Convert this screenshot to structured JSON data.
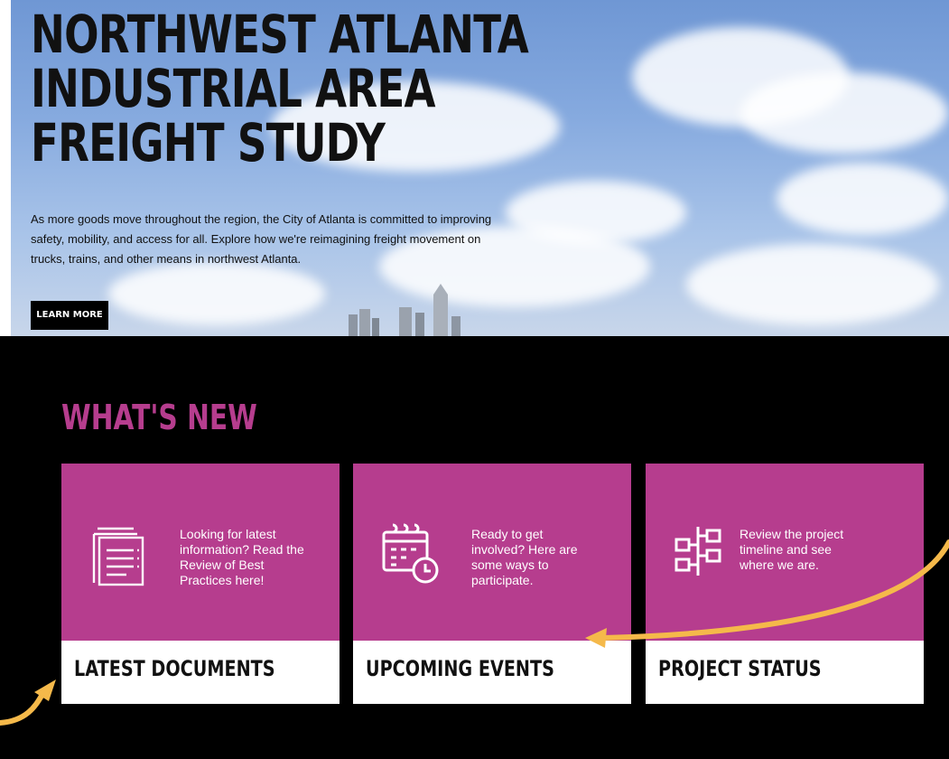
{
  "hero": {
    "title_lines": [
      "NORTHWEST ATLANTA",
      "INDUSTRIAL AREA",
      "FREIGHT STUDY"
    ],
    "description_lines": [
      "As more goods move throughout the region, the City of Atlanta is committed to improving",
      "safety, mobility, and access for all. Explore how we're reimagining freight movement on",
      "trucks, trains, and other means in northwest Atlanta."
    ],
    "cta_label": "LEARN MORE"
  },
  "whats_new": {
    "title": "WHAT'S NEW",
    "cards": [
      {
        "icon": "documents-icon",
        "text_lines": [
          "Looking for latest",
          "information? Read the",
          "Review of Best",
          "Practices here!"
        ],
        "label": "LATEST DOCUMENTS"
      },
      {
        "icon": "calendar-icon",
        "text_lines": [
          "Ready to get",
          "involved? Here are",
          "some ways to",
          "participate."
        ],
        "label": "UPCOMING EVENTS"
      },
      {
        "icon": "timeline-icon",
        "text_lines": [
          "Review the project",
          "timeline and see",
          "where we are."
        ],
        "label": "PROJECT STATUS"
      }
    ]
  },
  "colors": {
    "accent_magenta": "#b63d8e",
    "annotation_arrow": "#f5b94a",
    "background": "#000000"
  }
}
